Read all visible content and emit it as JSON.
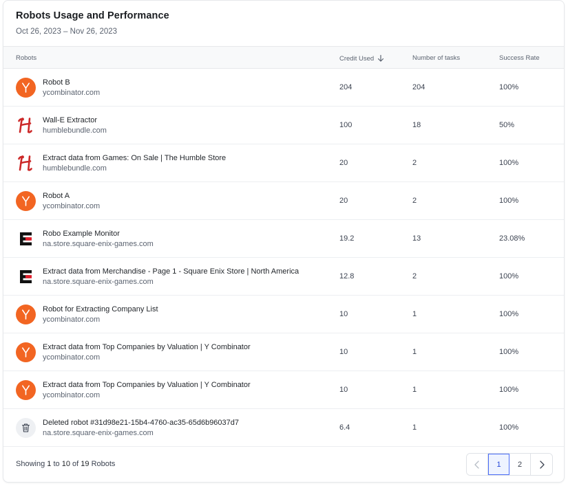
{
  "header": {
    "title": "Robots Usage and Performance",
    "date_range": "Oct 26, 2023 – Nov 26, 2023"
  },
  "columns": {
    "robots": "Robots",
    "credit_used": "Credit Used",
    "tasks": "Number of tasks",
    "success_rate": "Success Rate",
    "sort_icon": "arrow-down-icon"
  },
  "rows": [
    {
      "logo": "ycombinator-logo",
      "name": "Robot B",
      "domain": "ycombinator.com",
      "credit": "204",
      "tasks": "204",
      "rate": "100%"
    },
    {
      "logo": "humblebundle-logo",
      "name": "Wall-E Extractor",
      "domain": "humblebundle.com",
      "credit": "100",
      "tasks": "18",
      "rate": "50%"
    },
    {
      "logo": "humblebundle-logo",
      "name": "Extract data from Games: On Sale | The Humble Store",
      "domain": "humblebundle.com",
      "credit": "20",
      "tasks": "2",
      "rate": "100%"
    },
    {
      "logo": "ycombinator-logo",
      "name": "Robot A",
      "domain": "ycombinator.com",
      "credit": "20",
      "tasks": "2",
      "rate": "100%"
    },
    {
      "logo": "square-enix-logo",
      "name": "Robo Example Monitor",
      "domain": "na.store.square-enix-games.com",
      "credit": "19.2",
      "tasks": "13",
      "rate": "23.08%"
    },
    {
      "logo": "square-enix-logo",
      "name": "Extract data from Merchandise - Page 1 - Square Enix Store | North America",
      "domain": "na.store.square-enix-games.com",
      "credit": "12.8",
      "tasks": "2",
      "rate": "100%"
    },
    {
      "logo": "ycombinator-logo",
      "name": "Robot for Extracting Company List",
      "domain": "ycombinator.com",
      "credit": "10",
      "tasks": "1",
      "rate": "100%"
    },
    {
      "logo": "ycombinator-logo",
      "name": "Extract data from Top Companies by Valuation | Y Combinator",
      "domain": "ycombinator.com",
      "credit": "10",
      "tasks": "1",
      "rate": "100%"
    },
    {
      "logo": "ycombinator-logo",
      "name": "Extract data from Top Companies by Valuation | Y Combinator",
      "domain": "ycombinator.com",
      "credit": "10",
      "tasks": "1",
      "rate": "100%"
    },
    {
      "logo": "trash-icon",
      "name": "Deleted robot #31d98e21-15b4-4760-ac35-65d6b96037d7",
      "domain": "na.store.square-enix-games.com",
      "credit": "6.4",
      "tasks": "1",
      "rate": "100%"
    }
  ],
  "footer": {
    "showing": "Showing",
    "from": "1",
    "to_word": "to",
    "to": "10",
    "of_word": "of",
    "total": "19",
    "unit": "Robots"
  },
  "pagination": {
    "prev_icon": "chevron-left-icon",
    "pages": [
      "1",
      "2"
    ],
    "current": "1",
    "next_icon": "chevron-right-icon"
  },
  "colors": {
    "ycombinator": "#f26522",
    "humblebundle": "#cc2929",
    "square_enix": "#111111",
    "accent": "#4a6cf7"
  }
}
